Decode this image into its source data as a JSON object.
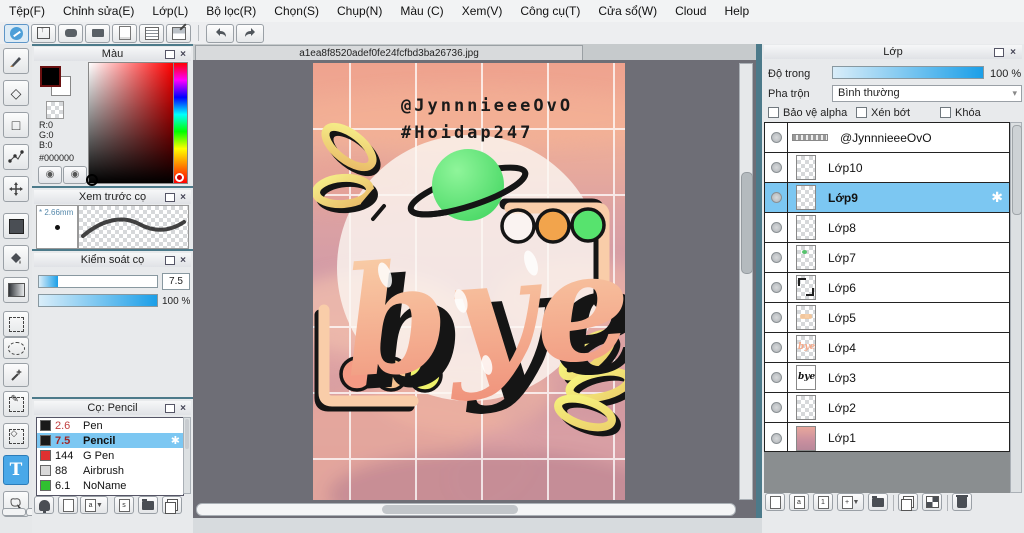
{
  "menu": {
    "items": [
      "Tệp(F)",
      "Chỉnh sửa(E)",
      "Lớp(L)",
      "Bộ lọc(R)",
      "Chọn(S)",
      "Chụp(N)",
      "Màu (C)",
      "Xem(V)",
      "Công cụ(T)",
      "Cửa sổ(W)",
      "Cloud",
      "Help"
    ]
  },
  "color_panel": {
    "title": "Màu",
    "r": "R:0",
    "g": "G:0",
    "b": "B:0",
    "hex": "#000000"
  },
  "brush_preview_panel": {
    "title": "Xem trước cọ",
    "size_label": "* 2.66mm"
  },
  "brush_control_panel": {
    "title": "Kiểm soát cọ",
    "size_value": "7.5",
    "opacity_value": "100 %"
  },
  "brush_list_panel": {
    "title": "Cọ: Pencil",
    "brushes": [
      {
        "size": "2.6",
        "name": "Pen",
        "swatch": "#1A1A1A",
        "selected": false
      },
      {
        "size": "7.5",
        "name": "Pencil",
        "swatch": "#1A1A1A",
        "selected": true
      },
      {
        "size": "144",
        "name": "G Pen",
        "swatch": "#E03030",
        "selected": false
      },
      {
        "size": "88",
        "name": "Airbrush",
        "swatch": "#D8D8D8",
        "selected": false
      },
      {
        "size": "6.1",
        "name": "NoName",
        "swatch": "#30C030",
        "selected": false
      }
    ]
  },
  "canvas": {
    "tab_title": "a1ea8f8520adef0fe24fcfbd3ba26736.jpg",
    "artwork": {
      "handle": "@JynnnieeeOvO",
      "hashtag": "#Hoidap247",
      "word": "bye",
      "colors": {
        "peach": "#F5A888",
        "yellow": "#EFF26B",
        "green": "#57E36E",
        "orange": "#F2A44C",
        "salmon": "#F49A84",
        "cream": "#F6C28F"
      }
    }
  },
  "layers_panel": {
    "title": "Lớp",
    "opacity_label": "Độ trong",
    "opacity_value": "100 %",
    "blend_label": "Pha trộn",
    "blend_value": "Bình thường",
    "checkbox_alpha": "Bảo vệ alpha",
    "checkbox_clip": "Xén bớt",
    "checkbox_lock": "Khóa",
    "layers": [
      {
        "name": "@JynnnieeeOvO",
        "selected": false
      },
      {
        "name": "Lớp10",
        "selected": false
      },
      {
        "name": "Lớp9",
        "selected": true
      },
      {
        "name": "Lớp8",
        "selected": false
      },
      {
        "name": "Lớp7",
        "selected": false
      },
      {
        "name": "Lớp6",
        "selected": false
      },
      {
        "name": "Lớp5",
        "selected": false
      },
      {
        "name": "Lớp4",
        "selected": false
      },
      {
        "name": "Lớp3",
        "selected": false
      },
      {
        "name": "Lớp2",
        "selected": false
      },
      {
        "name": "Lớp1",
        "selected": false
      }
    ]
  },
  "icons": {
    "gear": "✱",
    "caret": "▼"
  },
  "ui_colors": {
    "selection_blue": "#7CC7F2",
    "slider_blue": "#1B9FE8",
    "panel_teal": "#4C7A8A",
    "canvas_gray": "#6E6E76"
  }
}
